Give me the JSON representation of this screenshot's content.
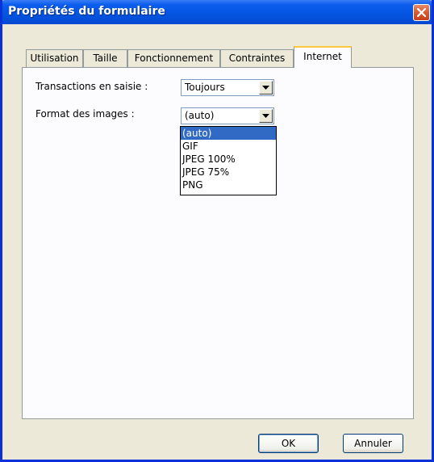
{
  "window": {
    "title": "Propriétés du formulaire"
  },
  "tabs": [
    {
      "label": "Utilisation"
    },
    {
      "label": "Taille"
    },
    {
      "label": "Fonctionnement"
    },
    {
      "label": "Contraintes"
    },
    {
      "label": "Internet",
      "active": true
    }
  ],
  "fields": {
    "transactions": {
      "label": "Transactions en saisie  :",
      "value": "Toujours"
    },
    "image_format": {
      "label": "Format des images :",
      "value": "(auto)",
      "options": [
        "(auto)",
        "GIF",
        "JPEG 100%",
        "JPEG 75%",
        "PNG"
      ],
      "selected_index": 0
    }
  },
  "buttons": {
    "ok": "OK",
    "cancel": "Annuler"
  },
  "icons": {
    "close": "close-icon",
    "dropdown": "chevron-down-icon"
  },
  "colors": {
    "titlebar": "#0454e0",
    "close_button": "#d85a32",
    "selection": "#316ac5",
    "active_tab_accent": "#ffc83c"
  }
}
